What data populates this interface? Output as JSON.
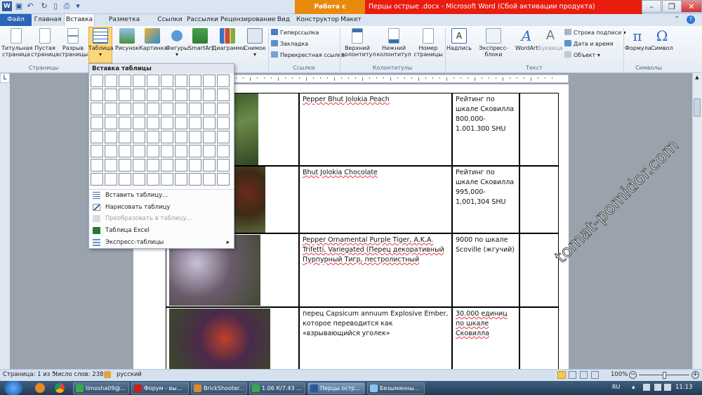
{
  "titlebar": {
    "ctx_tab": "Работа с таблицами",
    "title": "Перцы острые .docx - Microsoft Word (Сбой активации продукта)"
  },
  "tabs": {
    "file": "Файл",
    "home": "Главная",
    "insert": "Вставка",
    "layout": "Разметка страницы",
    "refs": "Ссылки",
    "mail": "Рассылки",
    "review": "Рецензирование",
    "view": "Вид",
    "constructor": "Конструктор",
    "maket": "Макет"
  },
  "ribbon": {
    "cover": "Титульная\nстраница",
    "blank": "Пустая\nстраница",
    "break": "Разрыв\nстраницы",
    "table": "Таблица",
    "picture": "Рисунок",
    "clipart": "Картинка",
    "shapes": "Фигуры",
    "smartart": "SmartArt",
    "chart": "Диаграмма",
    "screenshot": "Снимок",
    "hyperlink": "Гиперссылка",
    "bookmark": "Закладка",
    "crossref": "Перекрестная ссылка",
    "header": "Верхний\nколонтитул",
    "footer": "Нижний\nколонтитул",
    "pagenum": "Номер\nстраницы",
    "textbox": "Надпись",
    "quickparts": "Экспресс-блоки",
    "wordart": "WordArt",
    "dropcap": "Буквица",
    "sigline": "Строка подписи",
    "datetime": "Дата и время",
    "object": "Объект",
    "formula": "Формула",
    "symbol": "Символ",
    "g_pages": "Страницы",
    "g_links": "Ссылки",
    "g_hf": "Колонтитулы",
    "g_text": "Текст",
    "g_symbols": "Символы"
  },
  "popup": {
    "title": "Вставка таблицы",
    "items": [
      "Вставить таблицу...",
      "Нарисовать таблицу",
      "Преобразовать в таблицу...",
      "Таблица Excel",
      "Экспресс-таблицы"
    ]
  },
  "rows": [
    {
      "name": "Pepper Bhut Jolokia Peach",
      "rating": "Рейтинг по шкале Сковилла 800.000-1.001.300 SHU"
    },
    {
      "name": "Bhut Jolokia Chocolate",
      "rating": "Рейтинг по шкале Сковилла 995,000-1,001,304 SHU"
    },
    {
      "name": "Pepper Ornamental Purple Tiger, A.K.A. Trifetti, Variegated (Перец декоративный Пурпурный Тигр, пестролистный",
      "rating": "9000 по шкале Scoville (жгучий)"
    },
    {
      "name": "перец Capsicum annuum Explosive Ember, которое переводится как «взрывающийся уголек»",
      "rating": "30.000 единиц по шкале Сковилла"
    }
  ],
  "status": {
    "page": "Страница: 1 из 5",
    "words": "Число слов: 238",
    "lang": "русский",
    "zoom": "100%"
  },
  "taskbar": {
    "items": [
      "limosha09@...",
      "Форум - вы...",
      "BrickShooter...",
      "1.06 К/7.43 ...",
      "Перцы остр...",
      "Безымянны..."
    ],
    "lang": "RU",
    "time": "11:13"
  },
  "watermark": "tomat-pomidor.com",
  "colors": {
    "accent": "#2b579a",
    "title_red": "#e81c0f",
    "ctx_orange": "#e88a0c"
  }
}
